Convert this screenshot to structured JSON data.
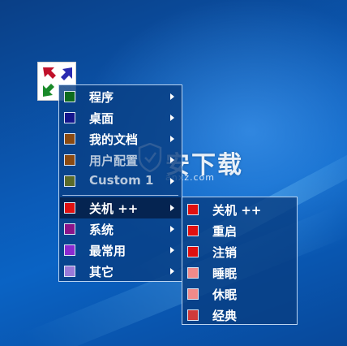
{
  "app_icon": {
    "name": "launcher-arrows-icon",
    "colors": [
      "#c0102a",
      "#2a2ab0",
      "#1a8a2a"
    ]
  },
  "main_menu": {
    "items": [
      {
        "label": "程序",
        "swatch": "#0e6b1e",
        "submenu": true
      },
      {
        "label": "桌面",
        "swatch": "#14148c",
        "submenu": true
      },
      {
        "label": "我的文档",
        "swatch": "#8a4a12",
        "submenu": true
      },
      {
        "label": "用户配置",
        "swatch": "#8a4a12",
        "submenu": true,
        "dim": true
      },
      {
        "label": "Custom 1",
        "swatch": "#5a6a2a",
        "submenu": true,
        "dim": true
      },
      {
        "label": "关机 ++",
        "swatch": "#e01010",
        "submenu": true,
        "active": true
      },
      {
        "label": "系统",
        "swatch": "#8a148a",
        "submenu": true
      },
      {
        "label": "最常用",
        "swatch": "#8a2ad0",
        "submenu": true
      },
      {
        "label": "其它",
        "swatch": "#9a7ad8",
        "submenu": true
      }
    ]
  },
  "sub_menu": {
    "items": [
      {
        "label": "关机 ++",
        "swatch": "#e01010"
      },
      {
        "label": "重启",
        "swatch": "#e01010"
      },
      {
        "label": "注销",
        "swatch": "#e01010"
      },
      {
        "label": "睡眠",
        "swatch": "#f08a8a"
      },
      {
        "label": "休眠",
        "swatch": "#f08a8a"
      },
      {
        "label": "经典",
        "swatch": "#d03a3a"
      }
    ]
  },
  "watermark": {
    "text": "安下载",
    "sub": "anxz.com"
  }
}
